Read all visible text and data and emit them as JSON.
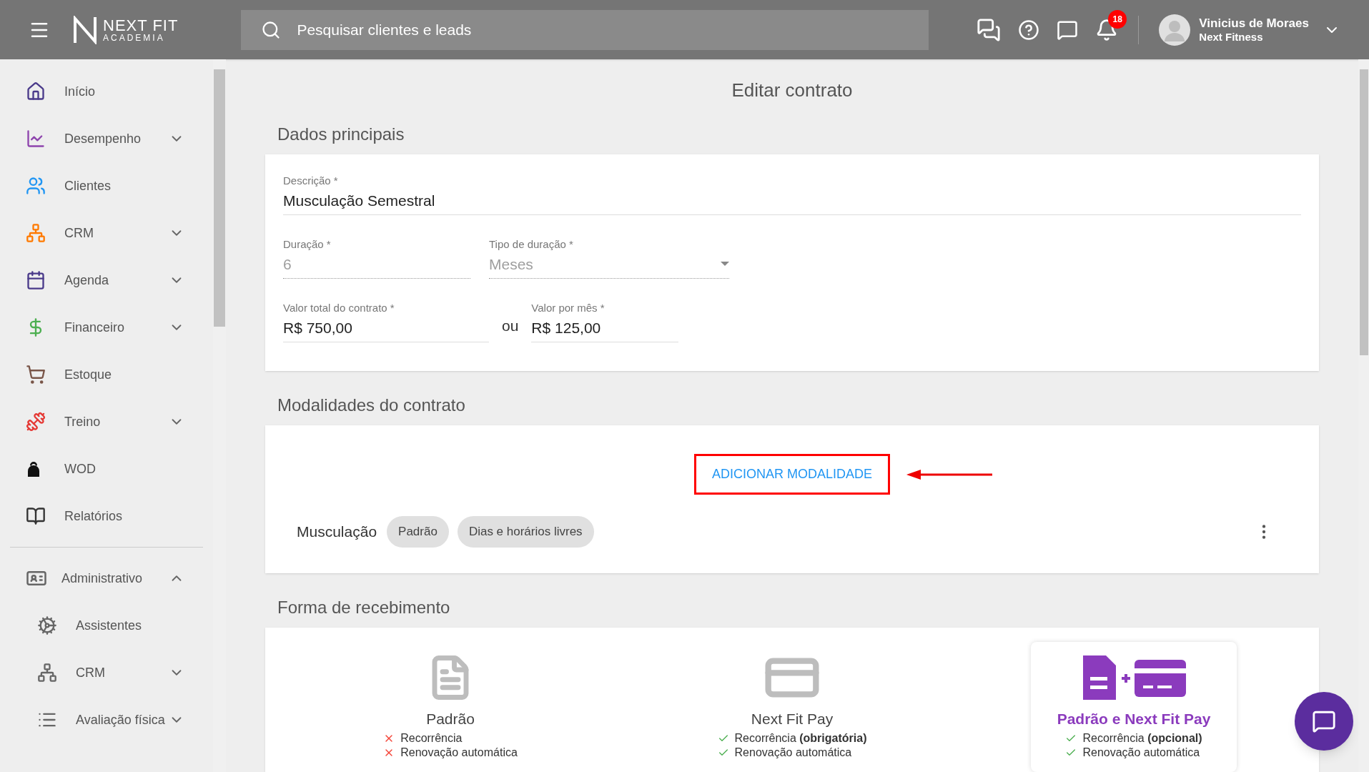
{
  "topbar": {
    "brand": "NEXT FIT",
    "brand_sub": "ACADEMIA",
    "search": {
      "placeholder": "Pesquisar clientes e leads"
    },
    "notifications": "18",
    "user": {
      "name": "Vinicius de Moraes",
      "company": "Next Fitness"
    }
  },
  "sidebar": {
    "items": [
      {
        "label": "Início",
        "expandable": false
      },
      {
        "label": "Desempenho",
        "expandable": true
      },
      {
        "label": "Clientes",
        "expandable": false
      },
      {
        "label": "CRM",
        "expandable": true
      },
      {
        "label": "Agenda",
        "expandable": true
      },
      {
        "label": "Financeiro",
        "expandable": true
      },
      {
        "label": "Estoque",
        "expandable": false
      },
      {
        "label": "Treino",
        "expandable": true
      },
      {
        "label": "WOD",
        "expandable": false
      },
      {
        "label": "Relatórios",
        "expandable": false
      }
    ],
    "admin": {
      "label": "Administrativo",
      "expanded": true,
      "children": [
        {
          "label": "Assistentes",
          "expandable": false
        },
        {
          "label": "CRM",
          "expandable": true
        },
        {
          "label": "Avaliação física",
          "expandable": true
        }
      ]
    }
  },
  "page": {
    "title": "Editar contrato"
  },
  "main_data": {
    "heading": "Dados principais",
    "description": {
      "label": "Descrição *",
      "value": "Musculação Semestral",
      "disabled": false
    },
    "duration": {
      "label": "Duração *",
      "value": "6",
      "disabled": true
    },
    "duration_type": {
      "label": "Tipo de duração *",
      "value": "Meses",
      "disabled": true
    },
    "total": {
      "label": "Valor total do contrato *",
      "value": "R$ 750,00",
      "disabled": false
    },
    "or": "ou",
    "monthly": {
      "label": "Valor por mês *",
      "value": "R$ 125,00",
      "disabled": false
    }
  },
  "modalities": {
    "heading": "Modalidades do contrato",
    "add_button": "ADICIONAR MODALIDADE",
    "rows": [
      {
        "name": "Musculação",
        "tags": [
          "Padrão",
          "Dias e horários livres"
        ]
      }
    ]
  },
  "payment": {
    "heading": "Forma de recebimento",
    "options": [
      {
        "title": "Padrão",
        "selected": false,
        "features": [
          {
            "text": "Recorrência",
            "ok": false
          },
          {
            "text": "Renovação automática",
            "ok": false
          }
        ]
      },
      {
        "title": "Next Fit Pay",
        "selected": false,
        "features": [
          {
            "text": "Recorrência **(obrigatória)**",
            "ok": true
          },
          {
            "text": "Renovação automática",
            "ok": true
          }
        ]
      },
      {
        "title": "Padrão e Next Fit Pay",
        "selected": true,
        "features": [
          {
            "text": "Recorrência **(opcional)**",
            "ok": true
          },
          {
            "text": "Renovação automática",
            "ok": true
          }
        ]
      }
    ]
  }
}
